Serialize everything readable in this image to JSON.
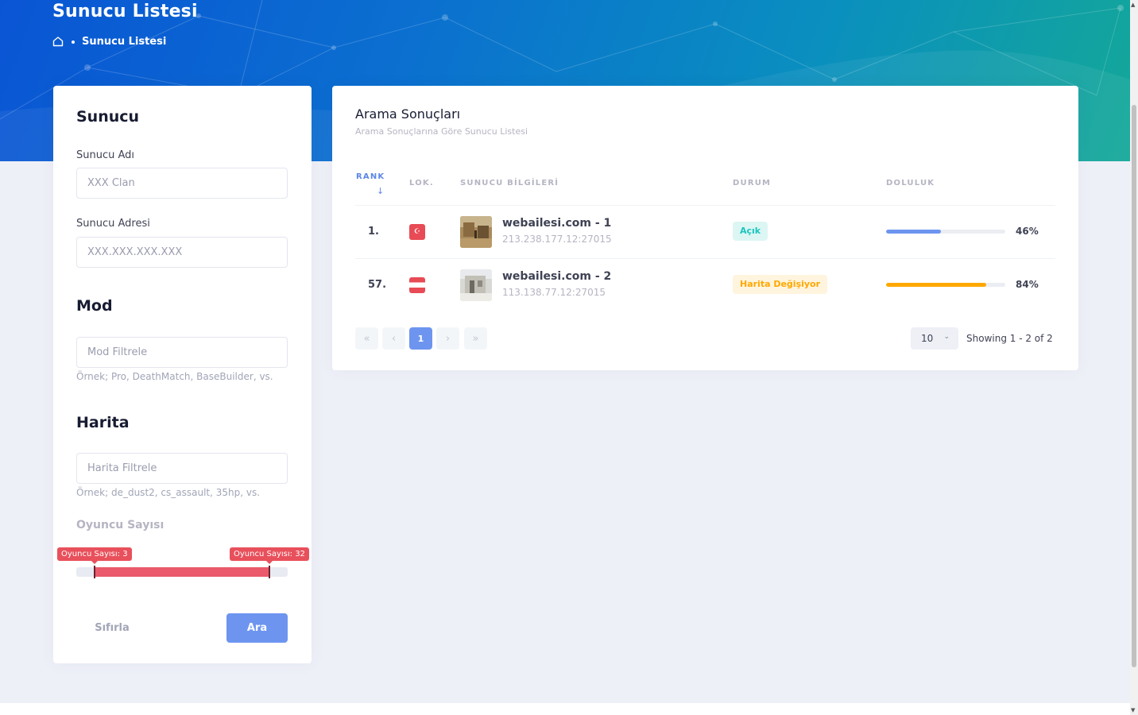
{
  "header": {
    "page_title": "Sunucu Listesi",
    "breadcrumb_current": "Sunucu Listesi"
  },
  "filters": {
    "server_section_title": "Sunucu",
    "server_name_label": "Sunucu Adı",
    "server_name_placeholder": "XXX Clan",
    "server_address_label": "Sunucu Adresi",
    "server_address_placeholder": "XXX.XXX.XXX.XXX",
    "mod_section_title": "Mod",
    "mod_placeholder": "Mod Filtrele",
    "mod_hint": "Örnek; Pro, DeathMatch, BaseBuilder, vs.",
    "map_section_title": "Harita",
    "map_placeholder": "Harita Filtrele",
    "map_hint": "Örnek; de_dust2, cs_assault, 35hp, vs.",
    "player_count_title": "Oyuncu Sayısı",
    "player_min_label": "Oyuncu Sayısı: 3",
    "player_max_label": "Oyuncu Sayısı: 32",
    "player_min": 3,
    "player_max": 32,
    "reset_label": "Sıfırla",
    "search_label": "Ara"
  },
  "results": {
    "title": "Arama Sonuçları",
    "subtitle": "Arama Sonuçlarına Göre Sunucu Listesi",
    "columns": {
      "rank": "RANK",
      "location": "LOK.",
      "server_info": "SUNUCU BİLGİLERİ",
      "status": "DURUM",
      "fullness": "DOLULUK"
    },
    "rows": [
      {
        "rank": "1.",
        "flag": "turkey-flag",
        "name": "webailesi.com - 1",
        "address": "213.238.177.12:27015",
        "status": "Açık",
        "fullness_pct": 46,
        "fullness_label": "46%",
        "bar_color": "#6d95f0"
      },
      {
        "rank": "57.",
        "flag": "austria-flag",
        "name": "webailesi.com - 2",
        "address": "113.138.77.12:27015",
        "status": "Harita Değişiyor",
        "fullness_pct": 84,
        "fullness_label": "84%",
        "bar_color": "#ffa800"
      }
    ],
    "pagination": {
      "current_page": "1",
      "page_size": "10",
      "showing": "Showing 1 - 2 of 2"
    }
  },
  "colors": {
    "accent": "#6d95f0",
    "slider": "#ea5a6b",
    "status_open": "#1bc5bd",
    "status_changing": "#ffa800"
  }
}
